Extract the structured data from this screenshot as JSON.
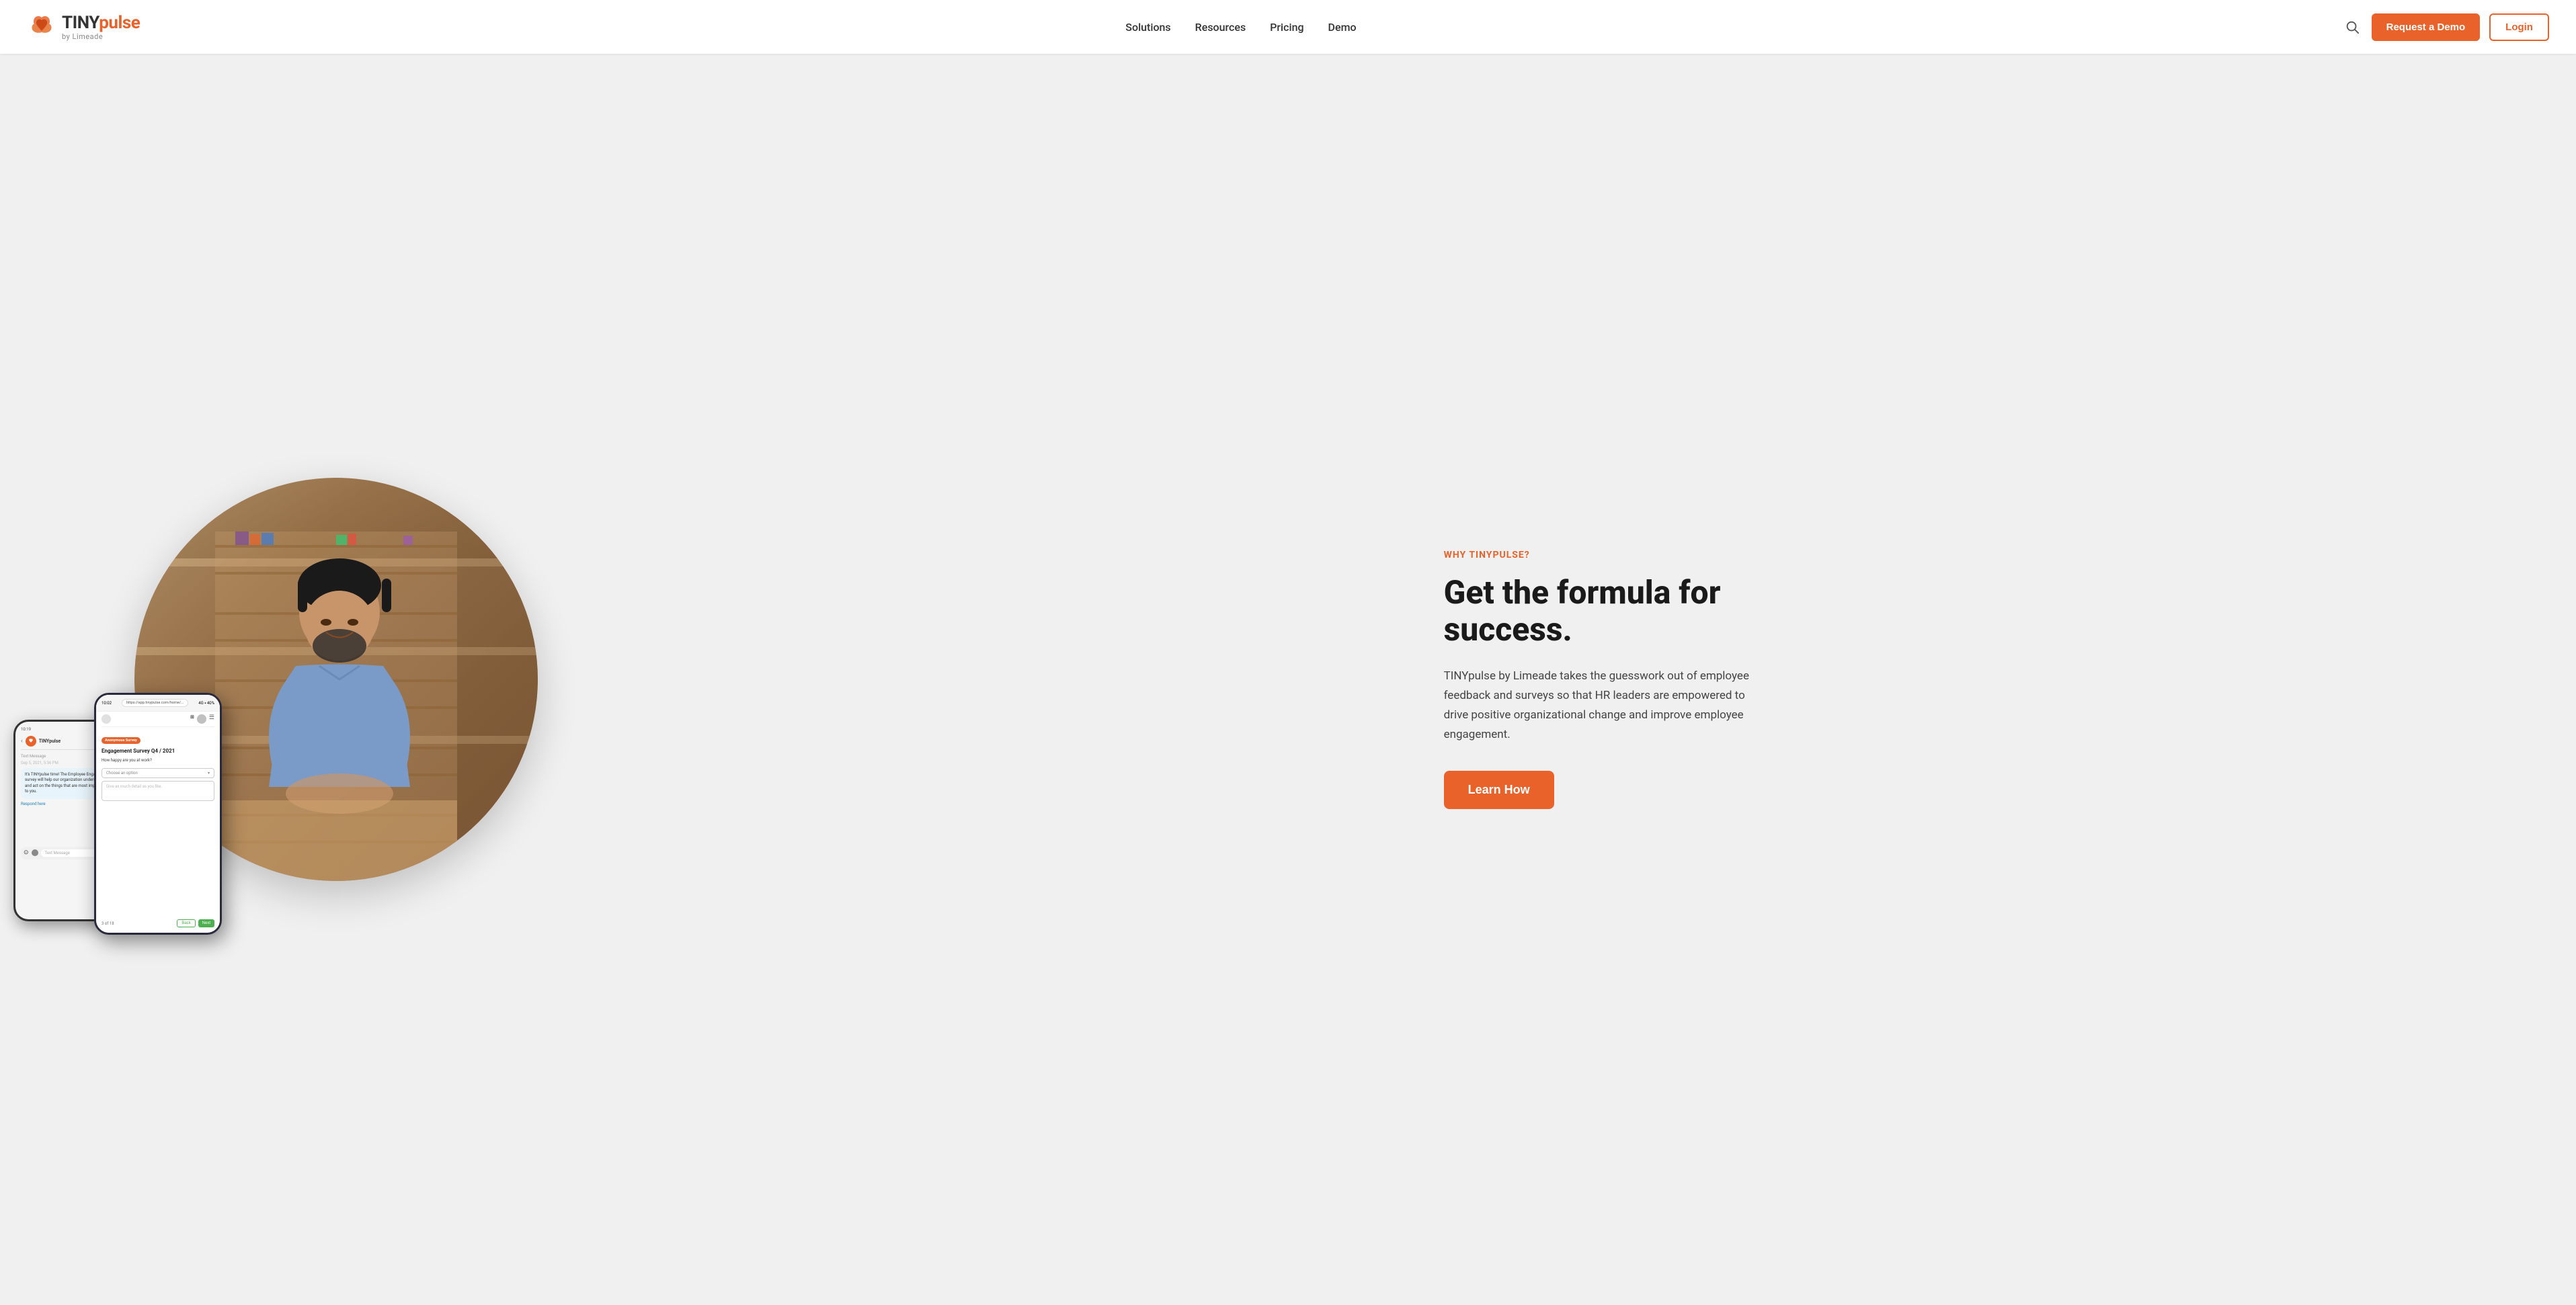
{
  "header": {
    "logo": {
      "tiny_text": "TINY",
      "pulse_text": "pulse",
      "by_text": "by Limeade"
    },
    "nav": {
      "items": [
        {
          "label": "Solutions",
          "id": "solutions"
        },
        {
          "label": "Resources",
          "id": "resources"
        },
        {
          "label": "Pricing",
          "id": "pricing"
        },
        {
          "label": "Demo",
          "id": "demo"
        }
      ]
    },
    "actions": {
      "request_demo_label": "Request a Demo",
      "login_label": "Login"
    }
  },
  "hero": {
    "why_label": "WHY TINYPULSE?",
    "headline_line1": "Get the formula for",
    "headline_line2": "success.",
    "description": "TINYpulse by Limeade takes the guesswork out of employee feedback and surveys so that HR leaders are empowered to drive positive organizational change and improve employee engagement.",
    "cta_label": "Learn How",
    "phone1": {
      "time": "10:19",
      "app_name": "TINYpulse",
      "message": "It's TINYpulse time! The Employee Engagement survey will help our organization understand and act on the things that are most important to you.",
      "link": "Respond here"
    },
    "phone2": {
      "time": "10:02",
      "url": "https://app.tinypulse.com/home/...",
      "badge": "Anonymous Survey",
      "survey_title": "Engagement Survey Q4 / 2021",
      "question": "How happy are you at work?",
      "placeholder_dropdown": "Choose an option",
      "placeholder_textarea": "Give as much detail as you like.",
      "page_count": "3 of 18",
      "btn_back": "Back",
      "btn_next": "Next"
    }
  }
}
